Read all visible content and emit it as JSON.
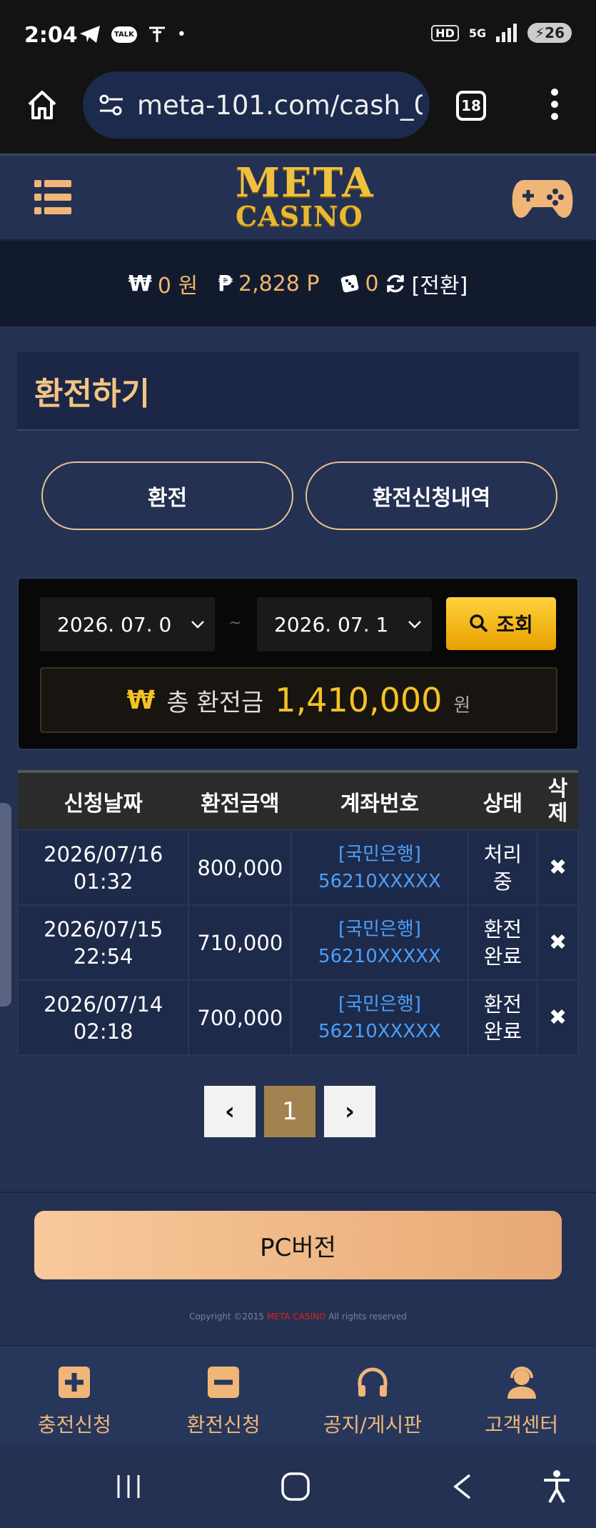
{
  "status_bar": {
    "time": "2:04",
    "talk_label": "TALK",
    "hd": "HD",
    "network": "5G",
    "battery": "26"
  },
  "browser": {
    "url": "meta-101.com/cash_0",
    "tab_count": "18"
  },
  "header": {
    "logo_top": "META",
    "logo_bottom": "CASINO"
  },
  "balance": {
    "won_symbol": "₩",
    "won_value": "0 원",
    "point_symbol": "₱",
    "point_value": "2,828 P",
    "dice_value": "0",
    "convert_label": "[전환]"
  },
  "page": {
    "title": "환전하기",
    "tab_withdraw": "환전",
    "tab_history": "환전신청내역"
  },
  "filter": {
    "date_from": "2026. 07. 0",
    "date_to": "2026. 07. 1",
    "tilde": "~",
    "search_label": "조회",
    "total_symbol": "₩",
    "total_label": "총 환전금",
    "total_value": "1,410,000",
    "total_unit": "원"
  },
  "table": {
    "headers": [
      "신청날짜",
      "환전금액",
      "계좌번호",
      "상태",
      "삭제"
    ],
    "rows": [
      {
        "date": "2026/07/16",
        "time": "01:32",
        "amount": "800,000",
        "bank": "[국민은행]",
        "account": "56210XXXXX",
        "status_1": "처리",
        "status_2": "중",
        "delete": "✖"
      },
      {
        "date": "2026/07/15",
        "time": "22:54",
        "amount": "710,000",
        "bank": "[국민은행]",
        "account": "56210XXXXX",
        "status_1": "환전",
        "status_2": "완료",
        "delete": "✖"
      },
      {
        "date": "2026/07/14",
        "time": "02:18",
        "amount": "700,000",
        "bank": "[국민은행]",
        "account": "56210XXXXX",
        "status_1": "환전",
        "status_2": "완료",
        "delete": "✖"
      }
    ]
  },
  "pager": {
    "prev": "‹",
    "current": "1",
    "next": "›"
  },
  "footer": {
    "pc_button": "PC버전",
    "copyright_prefix": "Copyright ©2015 ",
    "copyright_brand": "META CASINO",
    "copyright_suffix": " All rights reserved"
  },
  "bottom_nav": {
    "deposit": "충전신청",
    "withdraw": "환전신청",
    "notice": "공지/게시판",
    "support": "고객센터"
  },
  "colors": {
    "accent_gold": "#f5c125",
    "accent_peach": "#f0b678",
    "link_blue": "#4aa0ff",
    "background": "#243152"
  }
}
